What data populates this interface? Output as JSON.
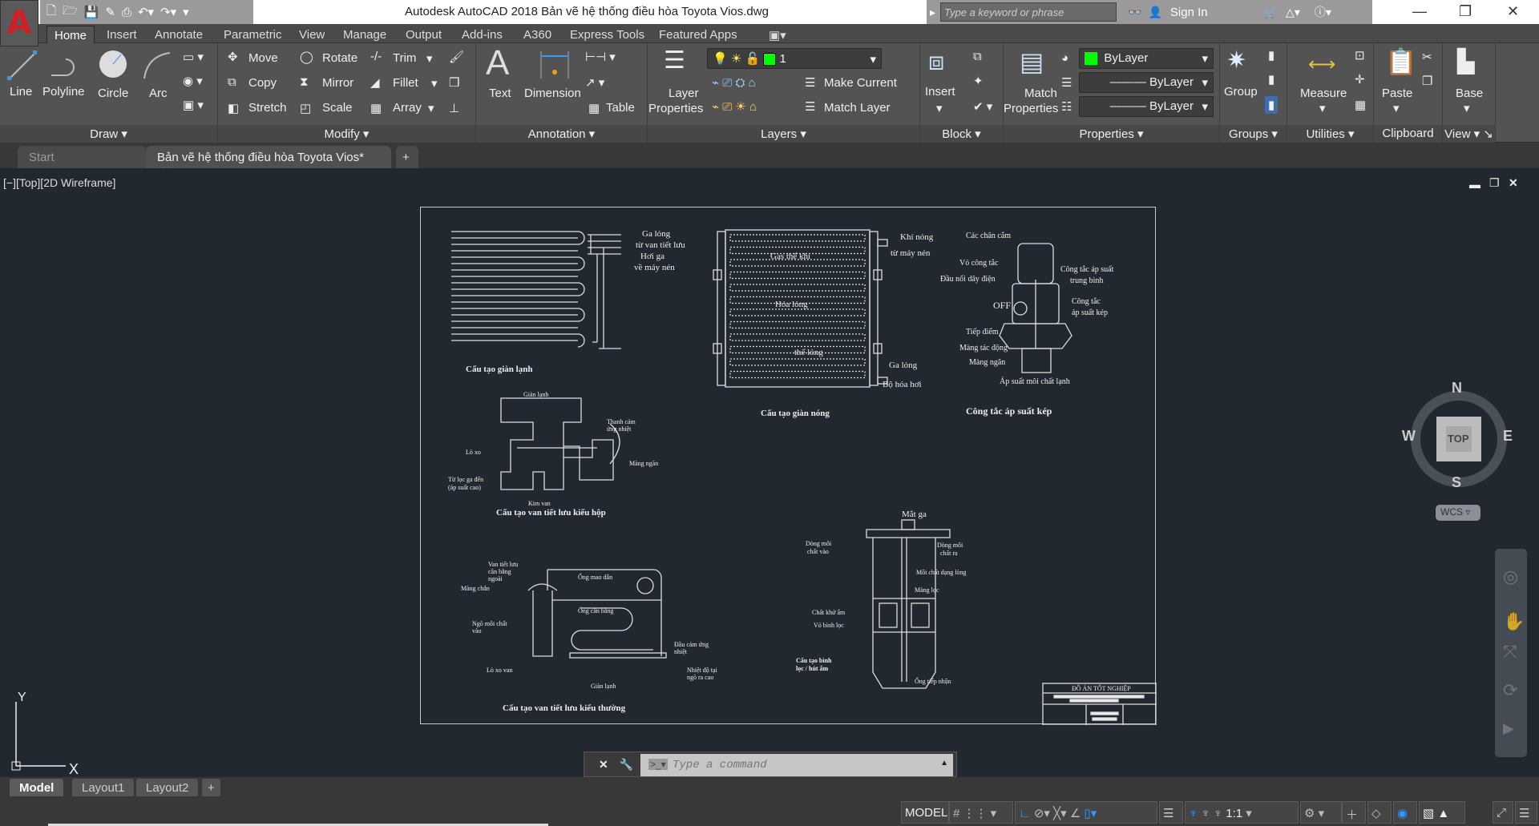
{
  "app": {
    "logo": "A",
    "window_title": "Autodesk AutoCAD 2018    Bản vẽ hệ thống điều hòa Toyota Vios.dwg",
    "search_placeholder": "Type a keyword or phrase",
    "sign_in": "Sign In",
    "window_controls": [
      "minimize-icon",
      "restore-icon",
      "close-icon"
    ]
  },
  "quick_access": [
    "new-icon",
    "open-icon",
    "save-icon",
    "save-as-icon",
    "print-icon",
    "undo-icon",
    "redo-icon",
    "customize-icon"
  ],
  "ribbon_tabs": [
    "Home",
    "Insert",
    "Annotate",
    "Parametric",
    "View",
    "Manage",
    "Output",
    "Add-ins",
    "A360",
    "Express Tools",
    "Featured Apps"
  ],
  "active_tab": "Home",
  "ribbon": {
    "draw": {
      "label": "Draw",
      "tools": [
        "Line",
        "Polyline",
        "Circle",
        "Arc"
      ]
    },
    "modify": {
      "label": "Modify",
      "tools": [
        "Move",
        "Rotate",
        "Trim",
        "Copy",
        "Mirror",
        "Fillet",
        "Stretch",
        "Scale",
        "Array"
      ]
    },
    "annotation": {
      "label": "Annotation",
      "tools": [
        "Text",
        "Dimension",
        "Table"
      ]
    },
    "layers": {
      "label": "Layers",
      "layer_properties": [
        "Layer",
        "Properties"
      ],
      "current_layer": "1",
      "layer_color": "#00ff00",
      "make_current": "Make Current",
      "match_layer": "Match Layer"
    },
    "block": {
      "label": "Block",
      "insert": "Insert"
    },
    "properties": {
      "label": "Properties",
      "match": [
        "Match",
        "Properties"
      ],
      "color": "ByLayer",
      "color_swatch": "#00ff00",
      "linetype": "ByLayer",
      "lineweight": "ByLayer"
    },
    "groups": {
      "label": "Groups",
      "group": "Group"
    },
    "utilities": {
      "label": "Utilities",
      "measure": "Measure"
    },
    "clipboard": {
      "label": "Clipboard",
      "paste": "Paste"
    },
    "view": {
      "label": "View",
      "base": "Base"
    }
  },
  "doc_tabs": [
    {
      "label": "Start",
      "active": false
    },
    {
      "label": "Bản vẽ hệ thống điều hòa Toyota Vios*",
      "active": true
    }
  ],
  "viewport": {
    "label": "[−][Top][2D Wireframe]",
    "viewcube": {
      "n": "N",
      "s": "S",
      "e": "E",
      "w": "W",
      "face": "TOP",
      "wcs": "WCS"
    },
    "ucs": {
      "x": "X",
      "y": "Y"
    }
  },
  "drawing": {
    "evaporator": {
      "title": "Cấu tạo giàn lạnh",
      "in1": "Ga lỏng",
      "in2": "từ van tiết lưu",
      "out1": "Hơi ga",
      "out2": "về máy nén"
    },
    "condenser": {
      "title": "Cấu tạo giàn nóng",
      "l1": "Khí nóng",
      "l2": "từ máy nén",
      "gas": "Gas thể khí",
      "liq": "Hóa lỏng",
      "liq2": "thể lỏng",
      "o1": "Ga lỏng",
      "o2": "Bộ hóa hơi"
    },
    "switch": {
      "title": "Công tắc áp suất kép",
      "pins": "Các chân cắm",
      "case": "Vỏ công tắc",
      "wire": "Đầu nối dây điện",
      "off": "OFF",
      "contact": "Tiếp điểm",
      "act": "Màng tác động",
      "block": "Màng ngăn",
      "mid1": "Công tắc áp suất",
      "mid2": "trung bình",
      "dual1": "Công tắc",
      "dual2": "áp suất kép",
      "press": "Áp suất môi chất lạnh"
    },
    "box_valve": {
      "title": "Cấu tạo van tiết lưu kiểu hộp",
      "evap": "Giàn lạnh",
      "spring": "Lò xo",
      "in1": "Từ lọc ga đến",
      "in2": "(áp suất cao)",
      "needle": "Kim van",
      "rod1": "Thanh cảm",
      "rod2": "ứng nhiệt",
      "diaph": "Màng ngăn"
    },
    "std_valve": {
      "title": "Cấu tạo van tiết lưu kiểu thường",
      "v1": "Van tiết lưu",
      "v2": "cân bằng",
      "v3": "ngoài",
      "diaph": "Màng chắn",
      "tube": "Ống mao dẫn",
      "bal": "Ống cân bằng",
      "in1": "Ngõ môi chất",
      "in2": "vào",
      "spring": "Lò xo van",
      "evap": "Giàn lạnh",
      "bulb1": "Đầu cảm ứng",
      "bulb2": "nhiệt",
      "out1": "Nhiệt độ tại",
      "out2": "ngõ ra cao"
    },
    "filter": {
      "title1": "Cấu tạo bình",
      "title2": "lọc / hút ẩm",
      "sight": "Mắt ga",
      "in1": "Dòng môi",
      "in2": "chất vào",
      "out1": "Dòng môi",
      "out2": "chất ra",
      "liq": "Môi chất dạng lỏng",
      "mesh": "Màng lọc",
      "des": "Chất khử ẩm",
      "shell": "Vỏ bình lọc",
      "pick": "Ống tiếp nhận"
    },
    "title_block": "ĐỒ ÁN TỐT NGHIỆP"
  },
  "command_line": {
    "placeholder": "Type a command"
  },
  "layout_tabs": [
    "Model",
    "Layout1",
    "Layout2"
  ],
  "status": {
    "space": "MODEL",
    "scale": "1:1"
  }
}
